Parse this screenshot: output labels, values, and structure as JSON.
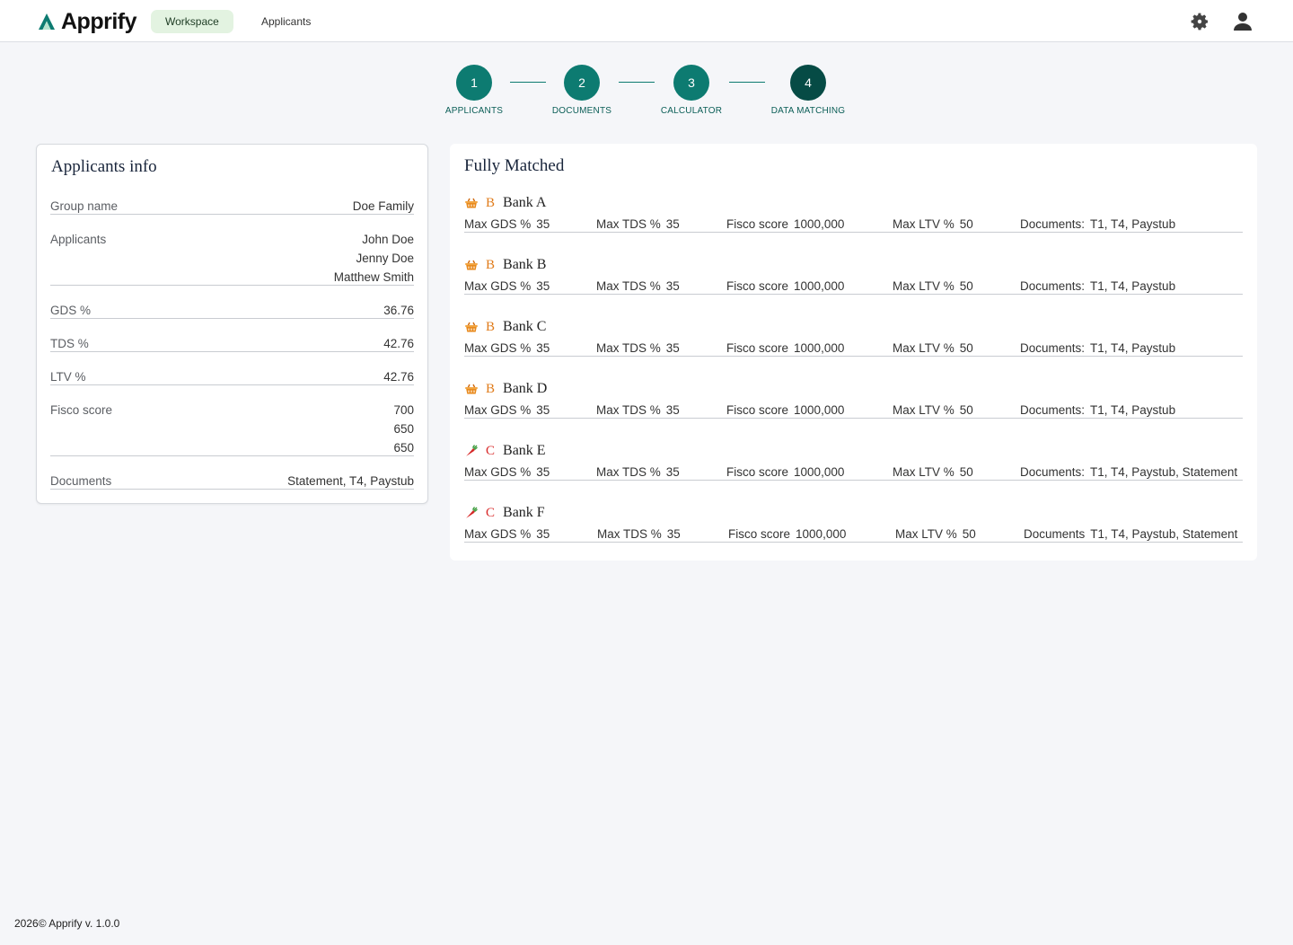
{
  "app": {
    "name": "Apprify",
    "brand_color": "#0d7b71"
  },
  "nav": {
    "tabs": [
      {
        "label": "Workspace",
        "active": true
      },
      {
        "label": "Applicants",
        "active": false
      }
    ]
  },
  "header_icons": [
    "gear-icon",
    "user-icon"
  ],
  "stepper": {
    "steps": [
      {
        "number": "1",
        "label": "APPLICANTS"
      },
      {
        "number": "2",
        "label": "DOCUMENTS"
      },
      {
        "number": "3",
        "label": "CALCULATOR"
      },
      {
        "number": "4",
        "label": "DATA MATCHING"
      }
    ],
    "current_step": 4
  },
  "applicants_info": {
    "title": "Applicants info",
    "rows": [
      {
        "label": "Group name",
        "values": [
          "Doe Family"
        ]
      },
      {
        "label": "Applicants",
        "values": [
          "John Doe",
          "Jenny Doe",
          "Matthew Smith"
        ]
      },
      {
        "label": "GDS %",
        "values": [
          "36.76"
        ]
      },
      {
        "label": "TDS %",
        "values": [
          "42.76"
        ]
      },
      {
        "label": "LTV %",
        "values": [
          "42.76"
        ]
      },
      {
        "label": "Fisco score",
        "values": [
          "700",
          "650",
          "650"
        ]
      },
      {
        "label": "Documents",
        "values": [
          "Statement, T4, Paystub"
        ]
      }
    ]
  },
  "matched": {
    "title": "Fully Matched",
    "grade_colors": {
      "B": "#e07b1a",
      "C": "#d92d2d"
    },
    "banks": [
      {
        "icon": "basket-icon",
        "grade": "B",
        "name": "Bank A",
        "max_gds_label": "Max GDS %",
        "max_gds": "35",
        "max_tds_label": "Max TDS %",
        "max_tds": "35",
        "fisco_label": "Fisco score",
        "fisco": "1000,000",
        "max_ltv_label": "Max LTV %",
        "max_ltv": "50",
        "documents_label": "Documents:",
        "documents": "T1, T4, Paystub"
      },
      {
        "icon": "basket-icon",
        "grade": "B",
        "name": "Bank B",
        "max_gds_label": "Max GDS %",
        "max_gds": "35",
        "max_tds_label": "Max TDS %",
        "max_tds": "35",
        "fisco_label": "Fisco score",
        "fisco": "1000,000",
        "max_ltv_label": "Max LTV %",
        "max_ltv": "50",
        "documents_label": "Documents:",
        "documents": "T1, T4, Paystub"
      },
      {
        "icon": "basket-icon",
        "grade": "B",
        "name": "Bank C",
        "max_gds_label": "Max GDS %",
        "max_gds": "35",
        "max_tds_label": "Max TDS %",
        "max_tds": "35",
        "fisco_label": "Fisco score",
        "fisco": "1000,000",
        "max_ltv_label": "Max LTV %",
        "max_ltv": "50",
        "documents_label": "Documents:",
        "documents": "T1, T4, Paystub"
      },
      {
        "icon": "basket-icon",
        "grade": "B",
        "name": "Bank D",
        "max_gds_label": "Max GDS %",
        "max_gds": "35",
        "max_tds_label": "Max TDS %",
        "max_tds": "35",
        "fisco_label": "Fisco score",
        "fisco": "1000,000",
        "max_ltv_label": "Max LTV %",
        "max_ltv": "50",
        "documents_label": "Documents:",
        "documents": "T1, T4, Paystub"
      },
      {
        "icon": "carrot-icon",
        "grade": "C",
        "name": "Bank E",
        "max_gds_label": "Max GDS %",
        "max_gds": "35",
        "max_tds_label": "Max TDS %",
        "max_tds": "35",
        "fisco_label": "Fisco score",
        "fisco": "1000,000",
        "max_ltv_label": "Max LTV %",
        "max_ltv": "50",
        "documents_label": "Documents:",
        "documents": "T1, T4, Paystub, Statement"
      },
      {
        "icon": "carrot-icon",
        "grade": "C",
        "name": "Bank F",
        "max_gds_label": "Max GDS %",
        "max_gds": "35",
        "max_tds_label": "Max TDS %",
        "max_tds": "35",
        "fisco_label": "Fisco score",
        "fisco": "1000,000",
        "max_ltv_label": "Max LTV %",
        "max_ltv": "50",
        "documents_label": "Documents",
        "documents": "T1, T4, Paystub, Statement"
      }
    ]
  },
  "footer": {
    "text": "2026© Apprify v. 1.0.0"
  }
}
